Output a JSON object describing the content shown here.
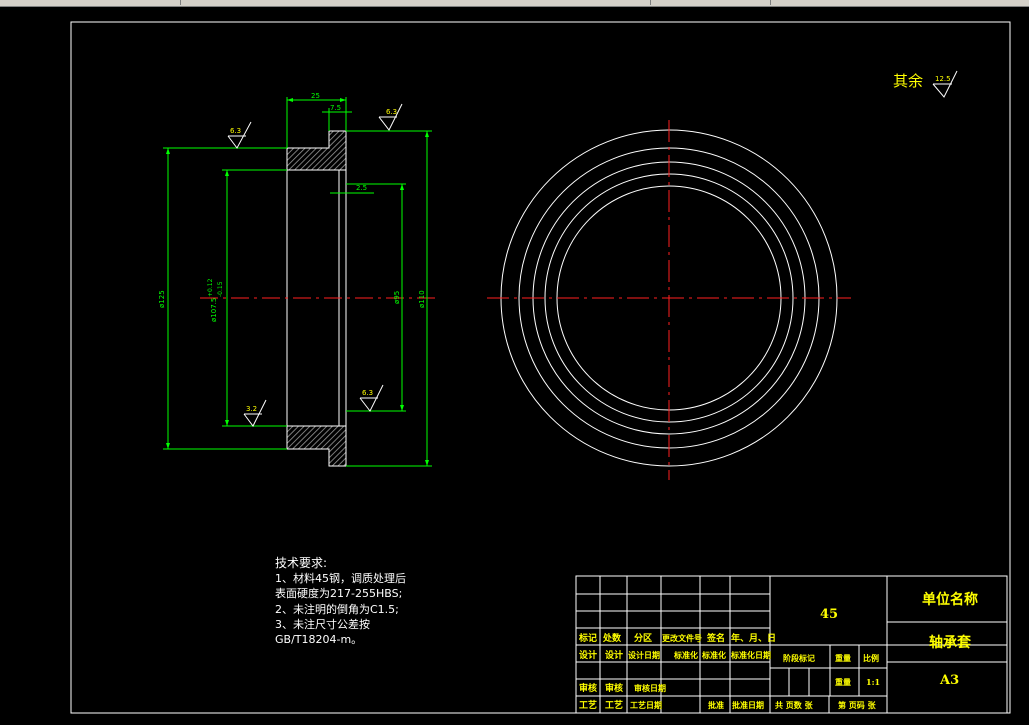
{
  "window": {
    "chrome_color": "#d4d0c8"
  },
  "colors": {
    "background": "#000000",
    "line": "#ffffff",
    "dimension": "#00ff00",
    "center": "#ff0000",
    "hatch": "#808080",
    "title_text": "#ffff00"
  },
  "drawing": {
    "rest_roughness_label": "其余",
    "rest_roughness_value": "12.5",
    "dimensions": {
      "width_top": "25",
      "step": "7.5",
      "groove": "2.5",
      "dia_left": "ø125",
      "dia_bore_main": "ø107.5",
      "dia_bore_tol_upper": "+0.12",
      "dia_bore_tol_lower": "-0.15",
      "dia_95": "ø95",
      "dia_110": "ø110"
    },
    "roughness": [
      "6.3",
      "6.3",
      "3.2",
      "6.3"
    ]
  },
  "technical_requirements": {
    "title": "技术要求:",
    "lines": [
      "1、材料45钢，调质处理后",
      "表面硬度为217-255HBS;",
      "2、未注明的倒角为C1.5;",
      "3、未注尺寸公差按",
      "GB/T18204-m。"
    ]
  },
  "title_block": {
    "material": "45",
    "company": "单位名称",
    "part_name": "轴承套",
    "sheet_size": "A3",
    "header_row": [
      "标记",
      "处数",
      "分区",
      "更改文件号",
      "签名",
      "年、月、日"
    ],
    "design_row": [
      "设计",
      "设计",
      "设计日期",
      "标准化",
      "标准化",
      "标准化日期"
    ],
    "stage": "阶段标记",
    "weight": "重量",
    "scale_label": "比例",
    "weight_value": "重量",
    "scale": "1:1",
    "review_row": [
      "审核",
      "审核",
      "审核日期"
    ],
    "process_row": [
      "工艺",
      "工艺",
      "工艺日期",
      "批准",
      "批准",
      "批准日期"
    ],
    "pages_total": "共 页数 张",
    "page_no": "第 页码 张"
  }
}
